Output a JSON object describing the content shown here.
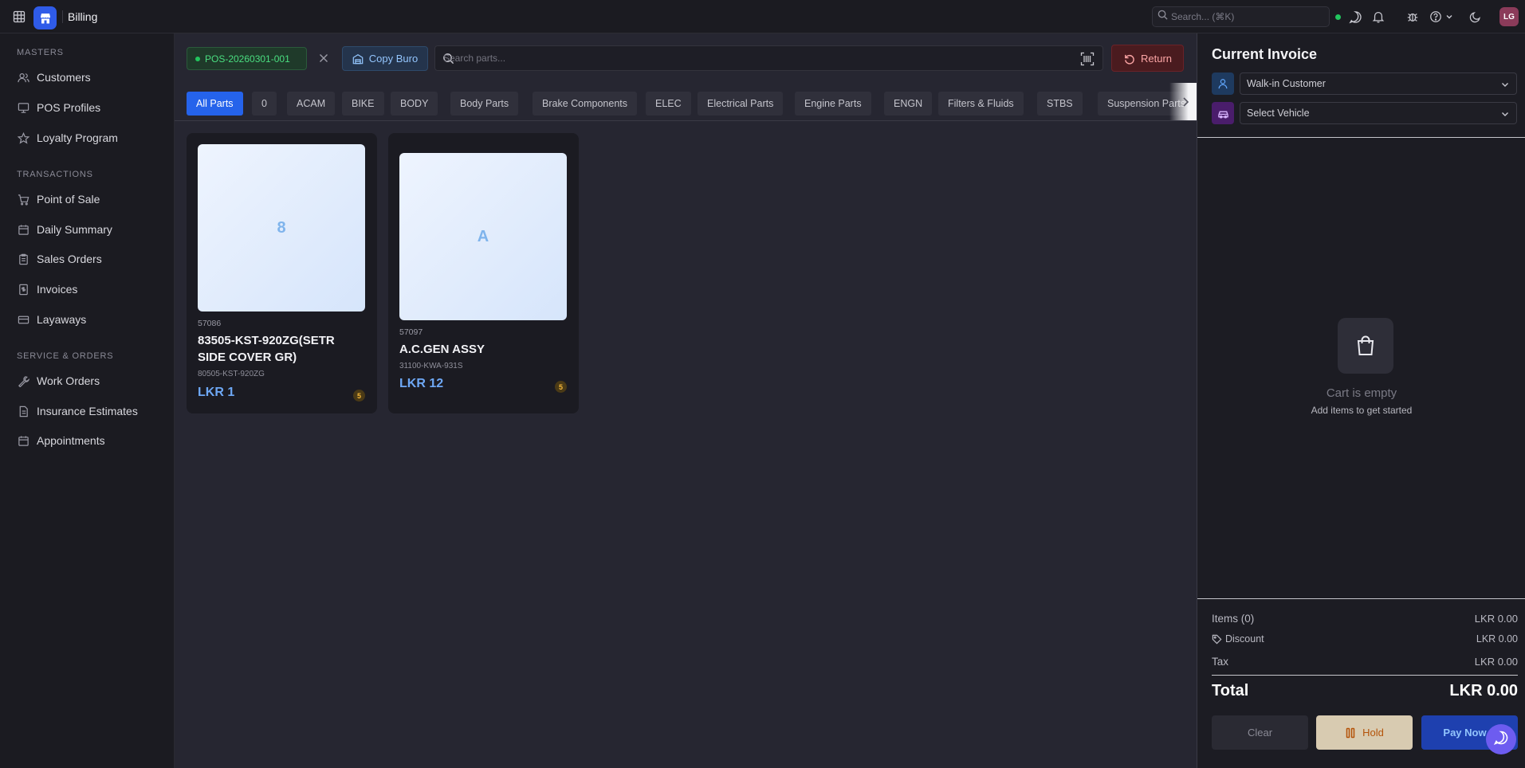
{
  "header": {
    "app_title": "Billing",
    "search_placeholder": "Search... (⌘K)",
    "avatar_initials": "LG",
    "icons": [
      "grid-icon",
      "store-logo-icon",
      "search-icon",
      "chat-icon",
      "bell-icon",
      "bug-icon",
      "help-icon",
      "chevron-down-icon",
      "moon-icon"
    ]
  },
  "sidebar": {
    "sections": [
      {
        "title": "MASTERS",
        "items": [
          {
            "label": "Customers",
            "icon": "users-icon"
          },
          {
            "label": "POS Profiles",
            "icon": "monitor-icon"
          },
          {
            "label": "Loyalty Program",
            "icon": "star-icon"
          }
        ]
      },
      {
        "title": "TRANSACTIONS",
        "items": [
          {
            "label": "Point of Sale",
            "icon": "cart-icon"
          },
          {
            "label": "Daily Summary",
            "icon": "calendar-icon"
          },
          {
            "label": "Sales Orders",
            "icon": "clipboard-icon"
          },
          {
            "label": "Invoices",
            "icon": "receipt-icon"
          },
          {
            "label": "Layaways",
            "icon": "card-icon"
          }
        ]
      },
      {
        "title": "SERVICE & ORDERS",
        "items": [
          {
            "label": "Work Orders",
            "icon": "wrench-icon"
          },
          {
            "label": "Insurance Estimates",
            "icon": "document-icon"
          },
          {
            "label": "Appointments",
            "icon": "calendar-icon"
          }
        ]
      }
    ]
  },
  "toolbar": {
    "session_id": "POS-20260301-001",
    "copy_label": "Copy Buro",
    "search_placeholder": "Search parts...",
    "return_label": "Return"
  },
  "categories": [
    "All Parts",
    "0",
    "ACAM",
    "BIKE",
    "BODY",
    "Body Parts",
    "Brake Components",
    "ELEC",
    "Electrical Parts",
    "Engine Parts",
    "ENGN",
    "Filters & Fluids",
    "STBS",
    "Suspension Parts"
  ],
  "active_category": "All Parts",
  "products": [
    {
      "initial": "8",
      "code": "57086",
      "name": "83505-KST-920ZG(SETR SIDE COVER GR)",
      "sku": "80505-KST-920ZG",
      "price": "LKR 1",
      "stock": "5"
    },
    {
      "initial": "A",
      "code": "57097",
      "name": "A.C.GEN ASSY",
      "sku": "31100-KWA-931S",
      "price": "LKR 12",
      "stock": "5"
    }
  ],
  "invoice": {
    "title": "Current Invoice",
    "customer": "Walk-in Customer",
    "vehicle_placeholder": "Select Vehicle",
    "empty_title": "Cart is empty",
    "empty_sub": "Add items to get started",
    "items_label": "Items (0)",
    "items_value": "LKR 0.00",
    "discount_label": "Discount",
    "discount_value": "LKR 0.00",
    "tax_label": "Tax",
    "tax_value": "LKR 0.00",
    "total_label": "Total",
    "total_value": "LKR 0.00",
    "clear_label": "Clear",
    "hold_label": "Hold",
    "pay_label": "Pay Now"
  },
  "colors": {
    "accent": "#2563eb",
    "price": "#6ea8f5",
    "success": "#22c55e",
    "danger": "#fca5a5"
  }
}
